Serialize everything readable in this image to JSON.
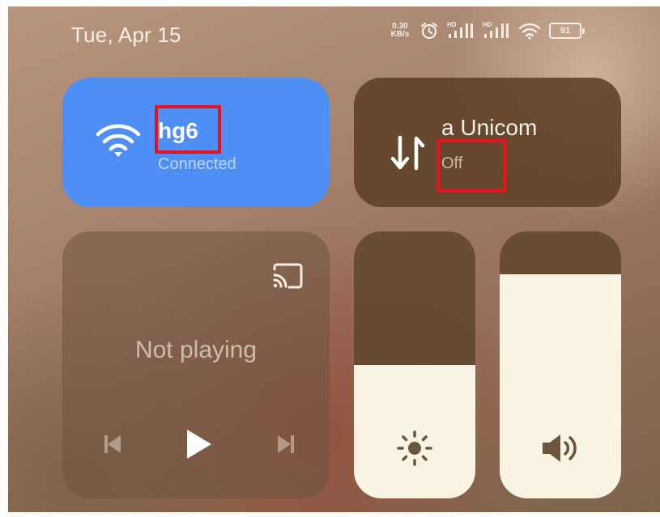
{
  "status_bar": {
    "date": "Tue, Apr 15",
    "net_speed_value": "0.30",
    "net_speed_unit": "KB/s",
    "signal_1_label": "HD",
    "signal_2_label": "HD",
    "battery_level": "91",
    "icons": [
      "alarm-icon",
      "signal-icon",
      "signal-icon",
      "wifi-icon",
      "battery-icon"
    ]
  },
  "wifi_tile": {
    "network_name": "hg6",
    "status": "Connected",
    "color": "#4d8ff4",
    "icon": "wifi-icon"
  },
  "data_tile": {
    "carrier": "a Unicom",
    "status": "Off",
    "icon": "mobile-data-icon"
  },
  "media_tile": {
    "state": "Not playing",
    "icons": [
      "cast-icon",
      "previous-icon",
      "play-icon",
      "next-icon"
    ]
  },
  "brightness_slider": {
    "level_percent": 50,
    "icon": "brightness-icon"
  },
  "volume_slider": {
    "level_percent": 84,
    "icon": "volume-icon"
  },
  "highlight_color": "#e8131c"
}
